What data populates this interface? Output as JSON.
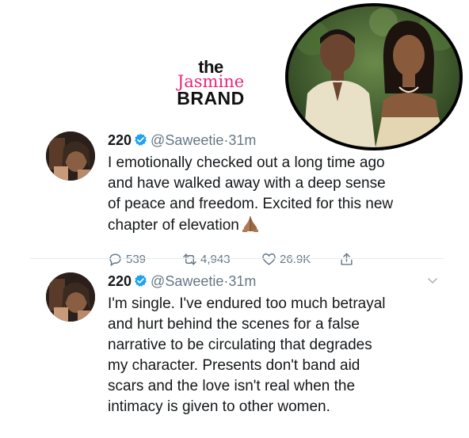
{
  "brand": {
    "line1": "the",
    "line2": "Jasmine",
    "line3": "BRAND"
  },
  "tweets": [
    {
      "name": "220",
      "handle": "@Saweetie",
      "separator": "·",
      "time": "31m",
      "lines": [
        "I emotionally checked out a long time ago",
        "and have walked away with a deep sense",
        "of peace and freedom. Excited for this new",
        "chapter of elevation"
      ],
      "emoji": "folded-hands",
      "replies": "539",
      "retweets": "4,943",
      "likes": "26.9K"
    },
    {
      "name": "220",
      "handle": "@Saweetie",
      "separator": "·",
      "time": "31m",
      "lines": [
        "I'm single. I've endured too much betrayal",
        "and hurt behind the scenes for a false",
        "narrative to be circulating that degrades",
        "my character. Presents don't band aid",
        "scars and the love isn't real when the",
        "intimacy is given to other women."
      ]
    }
  ],
  "colors": {
    "accent": "#1da1f2",
    "muted": "#657786",
    "brand_pink": "#e8267a"
  }
}
